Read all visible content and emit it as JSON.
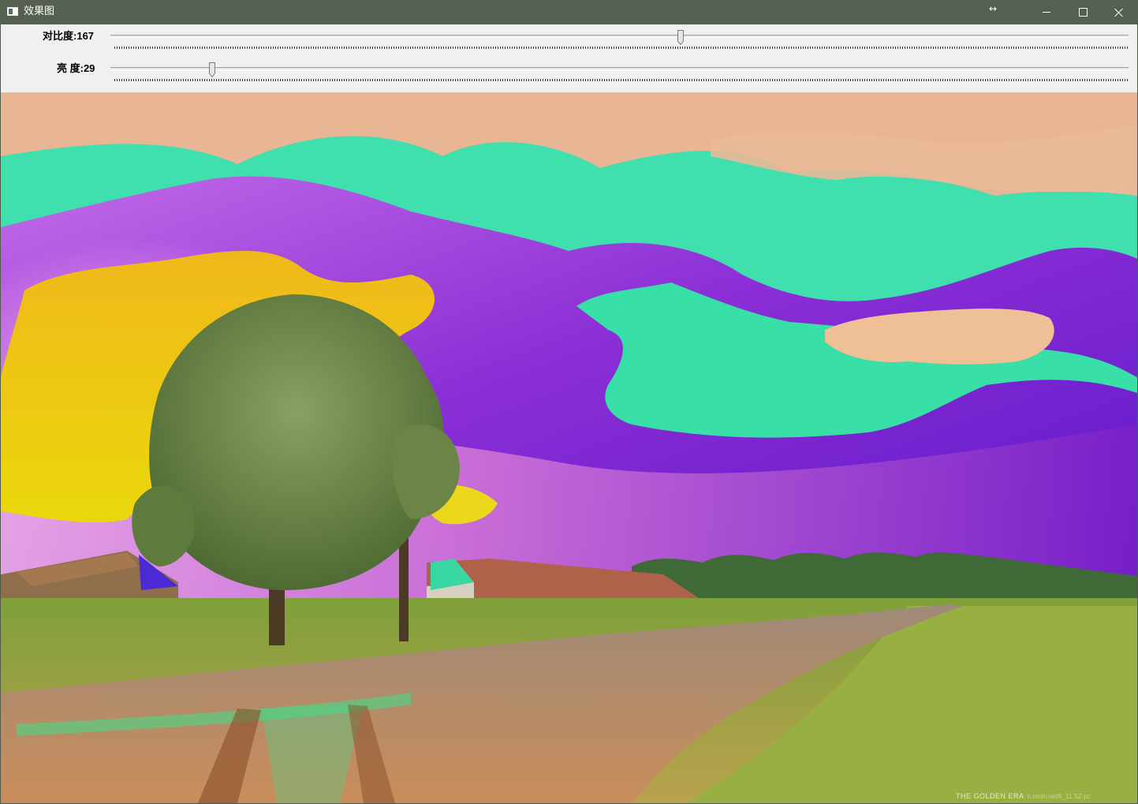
{
  "window": {
    "title": "效果图",
    "resize_indicator": "↔"
  },
  "trackbars": [
    {
      "label": "对比度:",
      "value": "167",
      "fraction": 0.56
    },
    {
      "label": "亮 度:",
      "value": "29",
      "fraction": 0.1
    }
  ],
  "image": {
    "description_text": "THE GOLDEN ERA",
    "url_text": "h.nsdn.net/ti_11 SZ-pc"
  },
  "colors": {
    "titlebar": "#556052",
    "toolbar": "#f0f0f0"
  }
}
